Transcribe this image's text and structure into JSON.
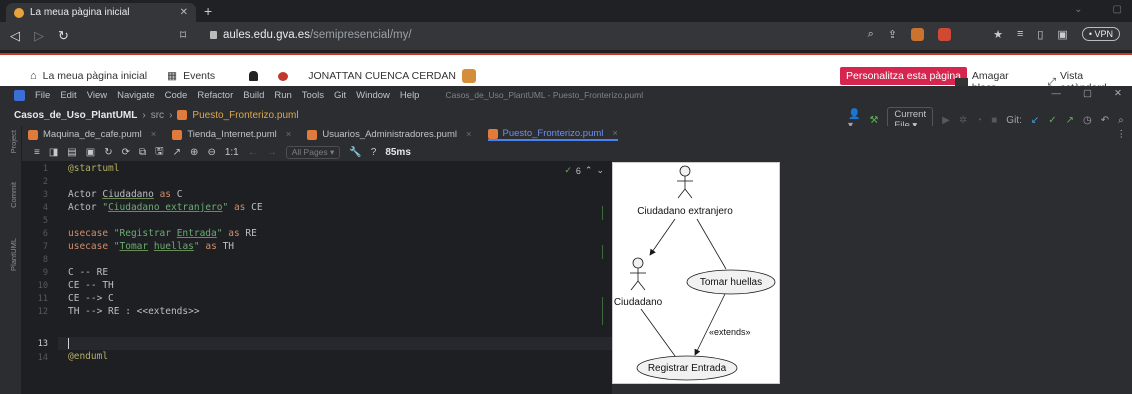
{
  "browser": {
    "tab_title": "La meua pàgina inicial",
    "url_host": "aules.edu.gva.es",
    "url_path": "/semipresencial/my/",
    "vpn": "VPN"
  },
  "moodle": {
    "home_link": "La meua pàgina inicial",
    "events_link": "Events",
    "user_name": "JONATTAN CUENCA CERDAN",
    "personalize_button": "Personalitza esta pàgina",
    "hide_blocks": "Amagar blocs",
    "standard_view": "Vista estàndard"
  },
  "ide": {
    "menu": [
      "File",
      "Edit",
      "View",
      "Navigate",
      "Code",
      "Refactor",
      "Build",
      "Run",
      "Tools",
      "Git",
      "Window",
      "Help"
    ],
    "window_title": "Casos_de_Uso_PlantUML - Puesto_Fronterizo.puml",
    "breadcrumb": {
      "project": "Casos_de_Uso_PlantUML",
      "folder": "src",
      "file": "Puesto_Fronterizo.puml"
    },
    "run_config": "Current File",
    "git_label": "Git:",
    "file_tabs": [
      {
        "label": "Maquina_de_cafe.puml",
        "active": false
      },
      {
        "label": "Tienda_Internet.puml",
        "active": false
      },
      {
        "label": "Usuarios_Administradores.puml",
        "active": false
      },
      {
        "label": "Puesto_Fronterizo.puml",
        "active": true
      }
    ],
    "side_labels": [
      "Project",
      "Commit",
      "PlantUML"
    ],
    "preview_toolbar": {
      "zoom_label": "1:1",
      "pages": "All Pages",
      "help": "?",
      "render_time": "85ms"
    },
    "inspections": "6",
    "line_numbers": [
      "1",
      "2",
      "3",
      "4",
      "5",
      "6",
      "7",
      "8",
      "9",
      "10",
      "11",
      "12",
      "13",
      "14"
    ],
    "code": {
      "l1": "@startuml",
      "l3_kw": "Actor",
      "l3_name": "Ciudadano",
      "l3_as": "as",
      "l3_alias": "C",
      "l4_kw": "Actor",
      "l4_str1": "\"",
      "l4_name": "Ciudadano extranjero",
      "l4_str2": "\"",
      "l4_as": "as",
      "l4_alias": "CE",
      "l6_kw": "usecase",
      "l6_str1": "\"Registrar ",
      "l6_name": "Entrada",
      "l6_str2": "\"",
      "l6_as": "as",
      "l6_alias": "RE",
      "l7_kw": "usecase",
      "l7_str1": "\"",
      "l7_name1": "Tomar",
      "l7_name2": "huellas",
      "l7_str2": "\"",
      "l7_as": "as",
      "l7_alias": "TH",
      "l9": "C -- RE",
      "l10": "CE -- TH",
      "l11": "CE --> C",
      "l12": "TH --> RE : <<extends>>",
      "l14": "@enduml"
    }
  },
  "diagram": {
    "actor_ce": "Ciudadano extranjero",
    "actor_c": "Ciudadano",
    "usecase_th": "Tomar huellas",
    "usecase_re": "Registrar Entrada",
    "extends_label": "«extends»"
  }
}
